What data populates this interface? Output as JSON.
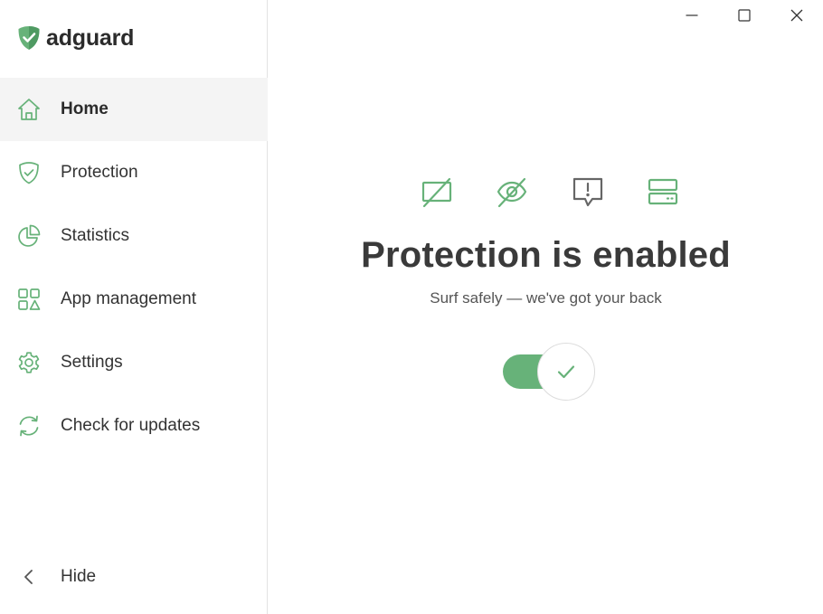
{
  "app": {
    "name": "adguard"
  },
  "colors": {
    "accent": "#67b279",
    "text": "#333333",
    "sidebar_active_bg": "#f4f4f4"
  },
  "sidebar": {
    "items": [
      {
        "label": "Home",
        "icon": "home-icon",
        "active": true
      },
      {
        "label": "Protection",
        "icon": "shield-icon",
        "active": false
      },
      {
        "label": "Statistics",
        "icon": "pie-chart-icon",
        "active": false
      },
      {
        "label": "App management",
        "icon": "grid-shapes-icon",
        "active": false
      },
      {
        "label": "Settings",
        "icon": "gear-icon",
        "active": false
      },
      {
        "label": "Check for updates",
        "icon": "refresh-icon",
        "active": false
      }
    ],
    "hide_label": "Hide"
  },
  "window_controls": [
    "minimize-icon",
    "maximize-icon",
    "close-icon"
  ],
  "main": {
    "feature_icons": [
      "ad-blocked-icon",
      "tracking-hidden-icon",
      "annoyance-icon",
      "server-icon"
    ],
    "title": "Protection is enabled",
    "subtitle": "Surf safely — we've got your back",
    "protection_toggle": {
      "state": "on"
    }
  }
}
